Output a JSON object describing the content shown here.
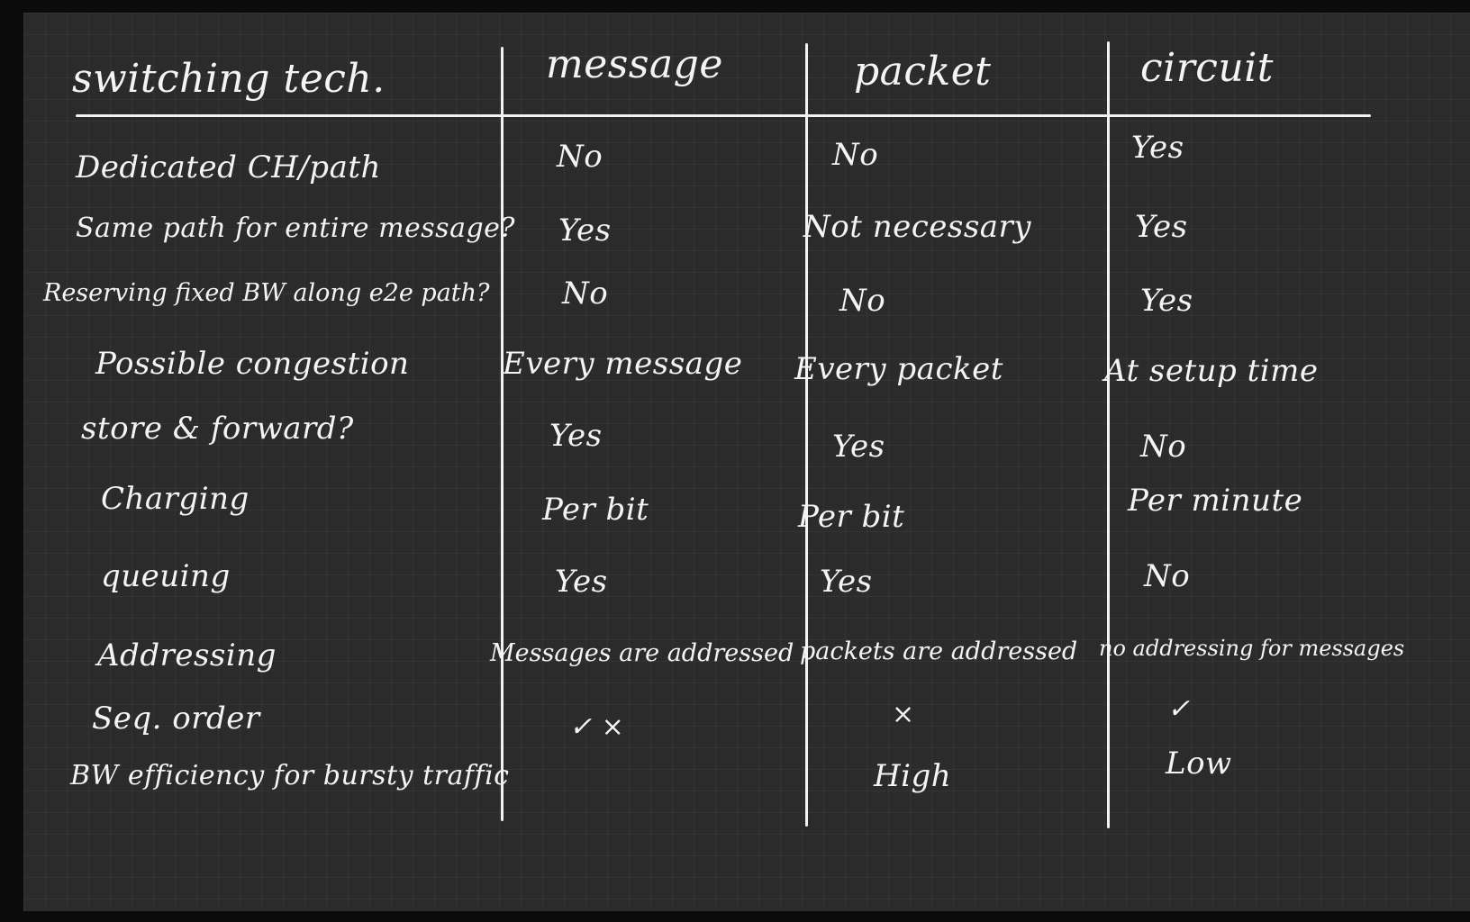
{
  "headers": {
    "row_label": "switching tech.",
    "message": "message",
    "packet": "packet",
    "circuit": "circuit"
  },
  "rows": [
    {
      "label": "Dedicated CH/path",
      "message": "No",
      "packet": "No",
      "circuit": "Yes"
    },
    {
      "label": "Same path for entire message?",
      "message": "Yes",
      "packet": "Not necessary",
      "circuit": "Yes"
    },
    {
      "label": "Reserving fixed BW along e2e path?",
      "message": "No",
      "packet": "No",
      "circuit": "Yes"
    },
    {
      "label": "Possible congestion",
      "message": "Every message",
      "packet": "Every packet",
      "circuit": "At setup time"
    },
    {
      "label": "store & forward?",
      "message": "Yes",
      "packet": "Yes",
      "circuit": "No"
    },
    {
      "label": "Charging",
      "message": "Per bit",
      "packet": "Per bit",
      "circuit": "Per minute"
    },
    {
      "label": "queuing",
      "message": "Yes",
      "packet": "Yes",
      "circuit": "No"
    },
    {
      "label": "Addressing",
      "message": "Messages are addressed",
      "packet": "packets are addressed",
      "circuit": "no addressing for messages"
    },
    {
      "label": "Seq. order",
      "message": "✓ ×",
      "packet": "×",
      "circuit": "✓"
    },
    {
      "label": "BW efficiency for bursty traffic",
      "message": "",
      "packet": "High",
      "circuit": "Low"
    }
  ]
}
